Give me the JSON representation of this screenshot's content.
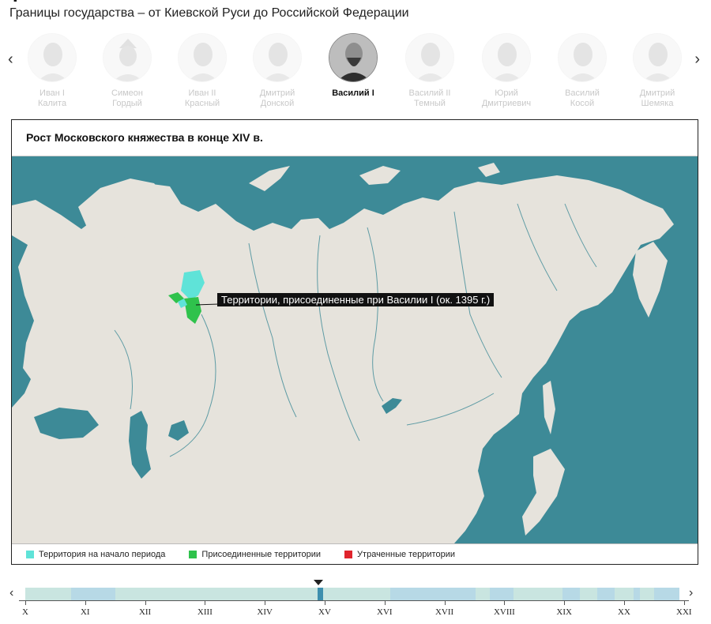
{
  "header": {
    "subtitle": "Границы государства – от Киевской Руси до Российской Федерации"
  },
  "rulers": [
    {
      "name_line1": "Иван I",
      "name_line2": "Калита",
      "active": false
    },
    {
      "name_line1": "Симеон",
      "name_line2": "Гордый",
      "active": false
    },
    {
      "name_line1": "Иван II",
      "name_line2": "Красный",
      "active": false
    },
    {
      "name_line1": "Дмитрий",
      "name_line2": "Донской",
      "active": false
    },
    {
      "name_line1": "Василий I",
      "name_line2": "",
      "active": true
    },
    {
      "name_line1": "Василий II",
      "name_line2": "Темный",
      "active": false
    },
    {
      "name_line1": "Юрий",
      "name_line2": "Дмитриевич",
      "active": false
    },
    {
      "name_line1": "Василий",
      "name_line2": "Косой",
      "active": false
    },
    {
      "name_line1": "Дмитрий",
      "name_line2": "Шемяка",
      "active": false
    }
  ],
  "nav": {
    "prev_icon": "‹",
    "next_icon": "›"
  },
  "map": {
    "title": "Рост Московского княжества в конце XIV в.",
    "tooltip": "Территории, присоединенные при Василии I (ок. 1395 г.)",
    "colors": {
      "sea": "#3d8a97",
      "land": "#e6e3dc",
      "initial": "#5fe3d8",
      "annexed": "#2fc24c",
      "lost": "#e0242c"
    }
  },
  "legend": [
    {
      "label": "Территория на начало периода",
      "color": "#5fe3d8"
    },
    {
      "label": "Присоединенные территории",
      "color": "#2fc24c"
    },
    {
      "label": "Утраченные территории",
      "color": "#e0242c"
    }
  ],
  "timeline": {
    "centuries": [
      "X",
      "XI",
      "XII",
      "XIII",
      "XIV",
      "XV",
      "XVI",
      "XVII",
      "XVIII",
      "XIX",
      "XX",
      "XXI"
    ],
    "selected_century": "XV",
    "prev_icon": "‹",
    "next_icon": "›"
  }
}
